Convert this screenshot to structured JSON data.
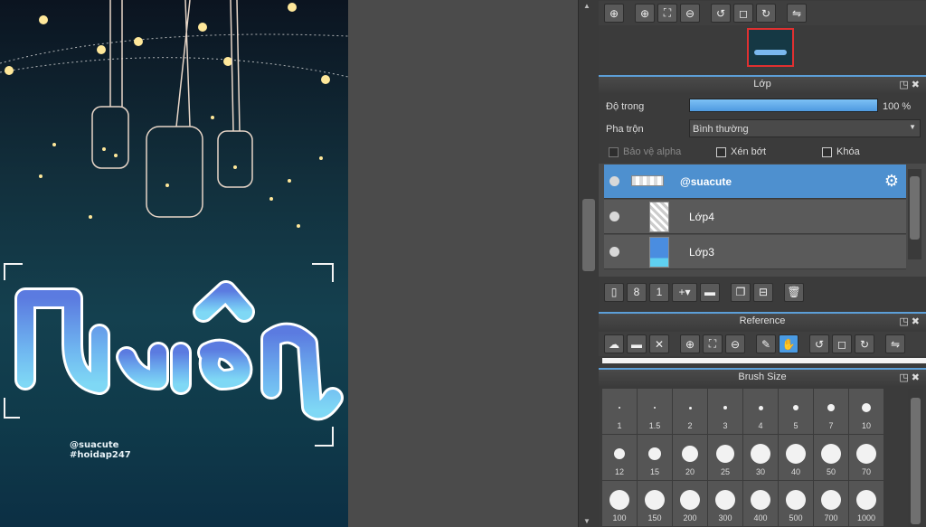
{
  "artwork": {
    "credit_handle": "@suacute",
    "credit_tag": "#hoidap247"
  },
  "navigator_toolbar": {
    "icons": [
      "zoom-icon",
      "zoom-in-icon",
      "fit-icon",
      "zoom-out-icon",
      "rotate-left-icon",
      "reset-icon",
      "rotate-right-icon",
      "flip-icon"
    ]
  },
  "layer_panel": {
    "title": "Lớp",
    "opacity_label": "Độ trong",
    "opacity_value": "100 %",
    "opacity_fraction": 1.0,
    "blend_label": "Pha trộn",
    "blend_value": "Bình thường",
    "protect_alpha": "Bảo vệ alpha",
    "clipping": "Xén bớt",
    "lock": "Khóa",
    "layers": [
      {
        "name": "@suacute",
        "selected": true
      },
      {
        "name": "Lớp4",
        "selected": false
      },
      {
        "name": "Lớp3",
        "selected": false
      }
    ]
  },
  "reference_panel": {
    "title": "Reference"
  },
  "brush_panel": {
    "title": "Brush Size",
    "sizes": [
      "1",
      "1.5",
      "2",
      "3",
      "4",
      "5",
      "7",
      "10",
      "12",
      "15",
      "20",
      "25",
      "30",
      "40",
      "50",
      "70",
      "100",
      "150",
      "200",
      "300",
      "400",
      "500",
      "700",
      "1000"
    ]
  },
  "colors": {
    "accent": "#4e90cf",
    "panel": "#3b3b3b"
  }
}
